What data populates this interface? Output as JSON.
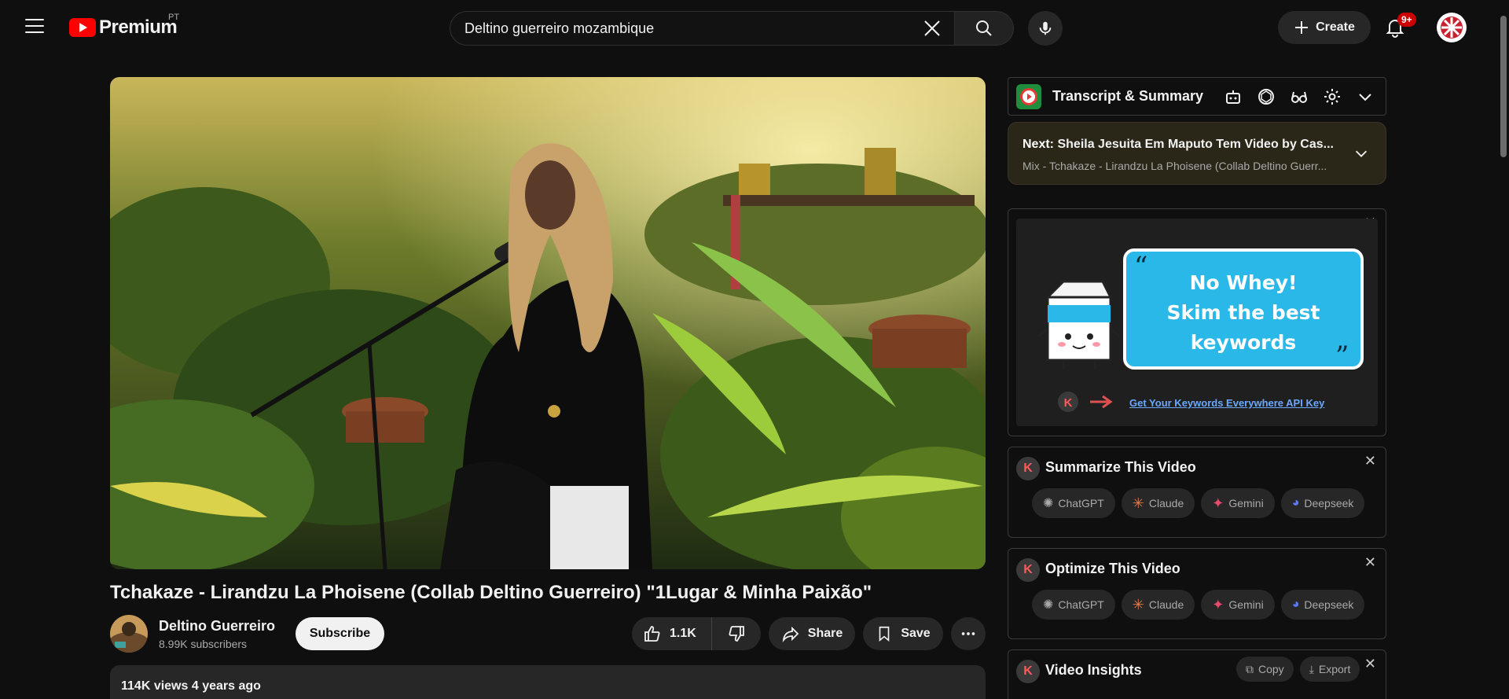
{
  "header": {
    "logo_text": "Premium",
    "region": "PT",
    "search_value": "Deltino guerreiro mozambique",
    "create_label": "Create",
    "notification_count": "9+"
  },
  "video": {
    "title": "Tchakaze - Lirandzu La Phoisene (Collab Deltino Guerreiro) \"1Lugar & Minha Paixão\"",
    "channel_name": "Deltino Guerreiro",
    "subscribers": "8.99K subscribers",
    "subscribe_label": "Subscribe",
    "likes": "1.1K",
    "share_label": "Share",
    "save_label": "Save",
    "meta": "114K views  4 years ago"
  },
  "sidebar": {
    "transcript_title": "Transcript & Summary",
    "next_label": "Next:",
    "next_title": "Sheila Jesuita Em Maputo Tem Video by Cas...",
    "next_sub": "Mix - Tchakaze - Lirandzu La Phoisene (Collab Deltino Guerr...",
    "ad": {
      "headline_1": "No Whey!",
      "headline_2": "Skim the best",
      "headline_3": "keywords",
      "link": "Get Your Keywords Everywhere API Key"
    },
    "cards": [
      {
        "title": "Summarize This Video",
        "buttons": [
          "ChatGPT",
          "Claude",
          "Gemini",
          "Deepseek"
        ]
      },
      {
        "title": "Optimize This Video",
        "buttons": [
          "ChatGPT",
          "Claude",
          "Gemini",
          "Deepseek"
        ]
      },
      {
        "title": "Video Insights",
        "actions": [
          "Copy",
          "Export"
        ]
      }
    ],
    "k_letter": "K"
  },
  "colors": {
    "youtube_red": "#ff0000",
    "background": "#0f0f0f",
    "chip": "#272727",
    "link_blue": "#6aa9ff",
    "ad_cyan": "#29b8e8"
  }
}
